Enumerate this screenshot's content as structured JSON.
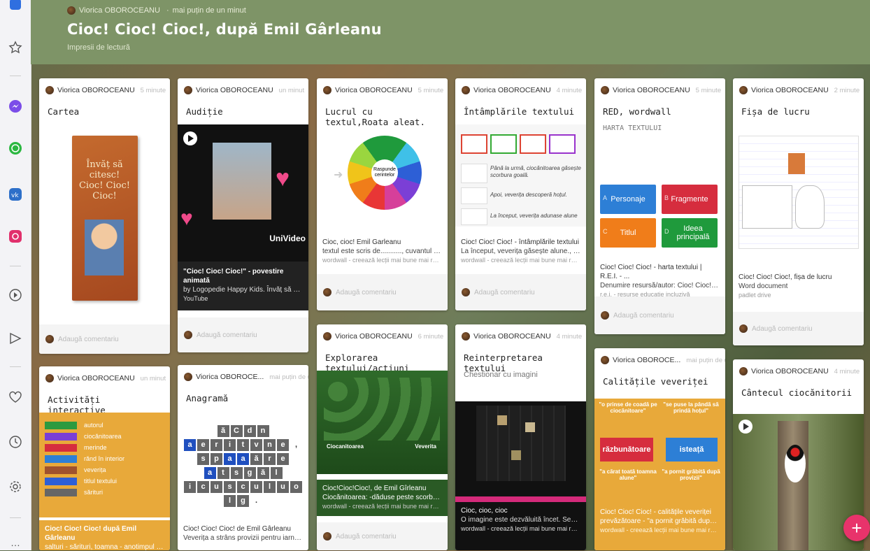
{
  "header": {
    "author": "Viorica OBOROCEANU",
    "time": "mai puțin de un minut",
    "title": "Cioc! Cioc! Cioc!, după Emil Gârleanu",
    "subtitle": "Impresii de lectură"
  },
  "comment_placeholder": "Adaugă comentariu",
  "cards": [
    {
      "author": "Viorica OBOROCEANU",
      "time": "5 minute",
      "title": "Cartea",
      "book_text": "Învăț să citesc! Cioc! Cioc! Cioc!"
    },
    {
      "author": "Viorica OBOROCEANU",
      "time": "un minut",
      "title": "Audiție",
      "brand": "UniVideo",
      "att_title": "\"Cioc! Cioc! Cioc!\" - povestire animată",
      "att_desc": "by Logopedie Happy Kids. Învăț să vorbe...",
      "att_source": "YouTube"
    },
    {
      "author": "Viorica OBOROCEANU",
      "time": "5 minute",
      "title": "Lucrul cu textul,Roata aleat.",
      "wheel_label": "Raspunde cerintelor",
      "att_title": "Cioc, cioc! Emil Garleanu",
      "att_desc": "textul este scris de..........., cuvantul cio...",
      "att_source": "wordwall - creează lecții mai bune mai repede"
    },
    {
      "author": "Viorica OBOROCEANU",
      "time": "4 minute",
      "title": "Întâmplările textului",
      "lines": [
        "Până la urmă, ciocănitoarea găsește scorbura goală.",
        "Apoi, veverița descoperă hoțul.",
        "La început, veverița adunase alune"
      ],
      "att_title": "Cioc! Cioc! Cioc! - întâmplările textului",
      "att_desc": "La început, veverița găsește alune., După...",
      "att_source": "wordwall - creează lecții mai bune mai repede"
    },
    {
      "author": "Viorica OBOROCEANU",
      "time": "5 minute",
      "title": "RED, wordwall",
      "subtitle": "HARTA TEXTULUI",
      "buttons": [
        {
          "letter": "A",
          "label": "Personaje",
          "color": "#2d7fd6"
        },
        {
          "letter": "B",
          "label": "Fragmente",
          "color": "#d62d3e"
        },
        {
          "letter": "C",
          "label": "Titlul",
          "color": "#f07d1a"
        },
        {
          "letter": "D",
          "label": "Ideea principală",
          "color": "#1f9a3c"
        }
      ],
      "att_title": "Cioc! Cioc! Cioc! - harta textului | R.E.I. - ...",
      "att_desc": "Denumire resursă/autor: Cioc! Cioc! Cioc...",
      "att_source": "r.e.i. - resurse educație incluzivă"
    },
    {
      "author": "Viorica OBOROCEANU",
      "time": "2 minute",
      "title": "Fișa de lucru",
      "att_title": "Cioc! Cioc! Cioc!, fișa de lucru",
      "att_desc": "Word document",
      "att_source": "padlet drive"
    },
    {
      "author": "Viorica OBOROCEANU",
      "time": "un minut",
      "title": "Activități interactive",
      "words": [
        "autorul",
        "ciocănitoarea",
        "merinde",
        "rănd în interior",
        "veverița",
        "titlul textului",
        "sărituri"
      ],
      "att_title": "Cioc! Cioc! Cioc! după Emil Gârleanu",
      "att_desc": "salturi - sărituri, toamna - anotimpul întâ..."
    },
    {
      "author": "Viorica OBOROCE...",
      "time": "mai puțin de un m...",
      "title": "Anagramă",
      "rows": [
        [
          "ă",
          "C",
          "d",
          "n"
        ],
        [
          "a",
          "e",
          "r",
          "i",
          "t",
          "v",
          "n",
          "e",
          ","
        ],
        [
          "s",
          "p",
          "a",
          "a",
          "ă",
          "r",
          "e"
        ],
        [
          "a",
          "t",
          "s",
          "g",
          "ă",
          "l"
        ],
        [
          "i",
          "c",
          "u",
          "s",
          "c",
          "u",
          "l",
          "u",
          "o",
          "l",
          "g",
          "."
        ]
      ],
      "att_title": "Cioc! Cioc! Cioc! de Emil Gârleanu",
      "att_desc": "Veverița a strâns provizii pentru iarnă., A ...",
      "att_source": "wordwall - creează lecții mai bune mai repede"
    },
    {
      "author": "Viorica OBOROCEANU",
      "time": "6 minute",
      "title": "Explorarea textului/acțiuni",
      "left_label": "Ciocanitoarea",
      "right_label": "Veverita",
      "att_title": "Cioc!Cioc!Cioc!, de Emil Gîrleanu",
      "att_desc": "Ciocănitoarea: -dăduse peste scorbură, -...",
      "att_source": "wordwall - creează lecții mai bune mai repede"
    },
    {
      "author": "Viorica OBOROCEANU",
      "time": "4 minute",
      "title": "Reinterpretarea textului",
      "subtitle": "Chestionar cu imagini",
      "att_title": "Cioc, cioc, cioc",
      "att_desc": "O imagine este dezvăluită încet. Semnal...",
      "att_source": "wordwall - creează lecții mai bune mai repede"
    },
    {
      "author": "Viorica OBOROCE...",
      "time": "mai puțin de un m...",
      "title": "Calitățile veveriței",
      "quotes": [
        "\"o prinse de coadă pe ciocănitoare\"",
        "\"se puse la pândă să prindă hoțul\"",
        "\"a cărat toată toamna alune\"",
        "\"a pornit grăbită după provizii\""
      ],
      "btn_left": "răzbunătoare",
      "btn_right": "isteață",
      "att_title": "Cioc! Cioc! Cioc! - calitățile veveriței",
      "att_desc": "prevăzătoare - \"a pornit grăbită după pro...",
      "att_source": "wordwall - creează lecții mai bune mai repede"
    },
    {
      "author": "Viorica OBOROCEANU",
      "time": "4 minute",
      "title": "Cântecul ciocănitorii"
    }
  ],
  "fab": "+"
}
